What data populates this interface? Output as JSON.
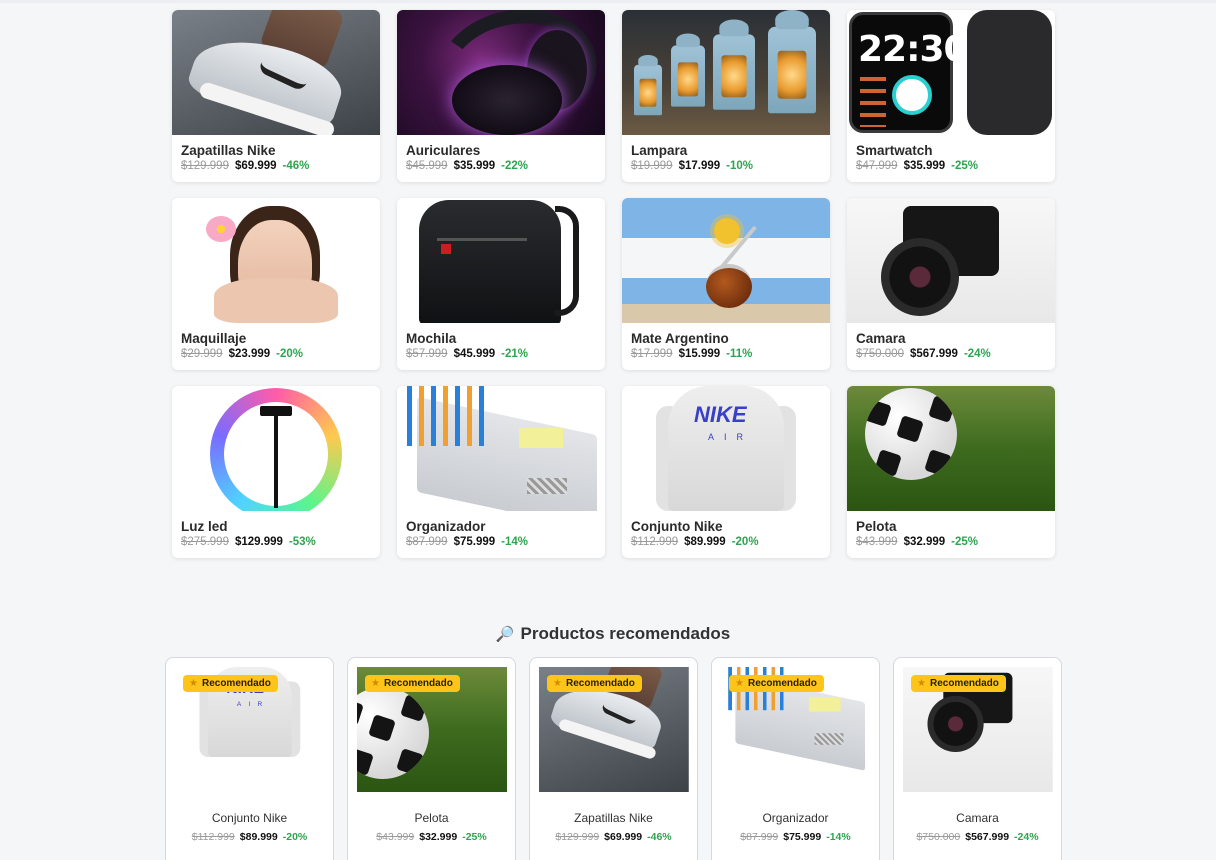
{
  "products": [
    {
      "name": "Zapatillas Nike",
      "old": "$129.999",
      "price": "$69.999",
      "discount": "-46%"
    },
    {
      "name": "Auriculares",
      "old": "$45.999",
      "price": "$35.999",
      "discount": "-22%"
    },
    {
      "name": "Lampara",
      "old": "$19.999",
      "price": "$17.999",
      "discount": "-10%"
    },
    {
      "name": "Smartwatch",
      "old": "$47.999",
      "price": "$35.999",
      "discount": "-25%"
    },
    {
      "name": "Maquillaje",
      "old": "$29.999",
      "price": "$23.999",
      "discount": "-20%"
    },
    {
      "name": "Mochila",
      "old": "$57.999",
      "price": "$45.999",
      "discount": "-21%"
    },
    {
      "name": "Mate Argentino",
      "old": "$17.999",
      "price": "$15.999",
      "discount": "-11%"
    },
    {
      "name": "Camara",
      "old": "$750.000",
      "price": "$567.999",
      "discount": "-24%"
    },
    {
      "name": "Luz led",
      "old": "$275.999",
      "price": "$129.999",
      "discount": "-53%"
    },
    {
      "name": "Organizador",
      "old": "$87.999",
      "price": "$75.999",
      "discount": "-14%"
    },
    {
      "name": "Conjunto Nike",
      "old": "$112.999",
      "price": "$89.999",
      "discount": "-20%"
    },
    {
      "name": "Pelota",
      "old": "$43.999",
      "price": "$32.999",
      "discount": "-25%"
    }
  ],
  "recommended": {
    "title": "Productos recomendados",
    "icon": "magnifier-icon",
    "badge": "Recomendado",
    "items": [
      {
        "name": "Conjunto Nike",
        "old": "$112.999",
        "price": "$89.999",
        "discount": "-20%"
      },
      {
        "name": "Pelota",
        "old": "$43.999",
        "price": "$32.999",
        "discount": "-25%"
      },
      {
        "name": "Zapatillas Nike",
        "old": "$129.999",
        "price": "$69.999",
        "discount": "-46%"
      },
      {
        "name": "Organizador",
        "old": "$87.999",
        "price": "$75.999",
        "discount": "-14%"
      },
      {
        "name": "Camara",
        "old": "$750.000",
        "price": "$567.999",
        "discount": "-24%"
      }
    ]
  },
  "watch_face": {
    "time": "22:30"
  },
  "hoodie_print": {
    "brand": "NIKE",
    "sub": "AIR"
  },
  "colors": {
    "discount": "#2ea44f",
    "badge": "#ffc41a",
    "background": "#f5f6f8"
  }
}
